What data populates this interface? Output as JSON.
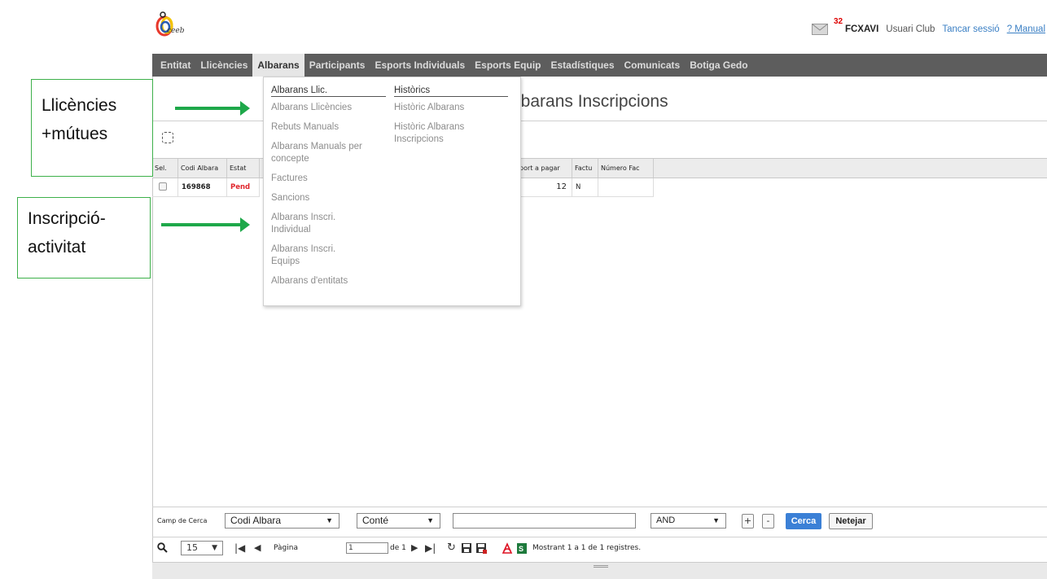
{
  "header": {
    "logo_text": "ceeb",
    "mail_count": "32",
    "user": "FCXAVI",
    "role": "Usuari Club",
    "logout": "Tancar sessió",
    "manual": "? Manual"
  },
  "nav": {
    "items": [
      "Entitat",
      "Llicències",
      "Albarans",
      "Participants",
      "Esports Individuals",
      "Esports Equip",
      "Estadístiques",
      "Comunicats",
      "Botiga Gedo"
    ],
    "active": "Albarans"
  },
  "page": {
    "title": "lbarans Inscripcions"
  },
  "grid": {
    "headers": [
      "Sel.",
      "Codi Albara",
      "Estat",
      "port a pagar",
      "Factu",
      "Número Fac"
    ],
    "rows": [
      {
        "codi": "169868",
        "estat": "Pend",
        "import": "12",
        "factu": "N",
        "numero": ""
      }
    ]
  },
  "dropdown": {
    "col1_header": "Albarans Llic.",
    "col1_items": [
      "Albarans Llicències",
      "Rebuts Manuals",
      "Albarans Manuals per concepte",
      "Factures",
      "Sancions",
      "Albarans Inscri. Individual",
      "Albarans Inscri. Equips",
      "Albarans d'entitats"
    ],
    "col2_header": "Històrics",
    "col2_items": [
      "Històric Albarans",
      "Històric Albarans Inscripcions"
    ]
  },
  "callouts": {
    "first": [
      "Llicències",
      "+mútues"
    ],
    "second": [
      "Inscripció-",
      "activitat"
    ]
  },
  "search": {
    "label": "Camp de Cerca",
    "field": "Codi Albara",
    "operator": "Conté",
    "value": "",
    "logic": "AND",
    "add": "+",
    "remove": "-",
    "search_btn": "Cerca",
    "clear_btn": "Netejar"
  },
  "pager": {
    "page_size": "15",
    "page_label": "Pàgina",
    "page_value": "1",
    "of_label": "de 1",
    "status": "Mostrant 1 a 1 de 1 registres."
  },
  "colors": {
    "navbar": "#5d5d5d",
    "accent_blue": "#3b80d6",
    "arrow_green": "#1ea84a",
    "pending_red": "#e0252c"
  }
}
